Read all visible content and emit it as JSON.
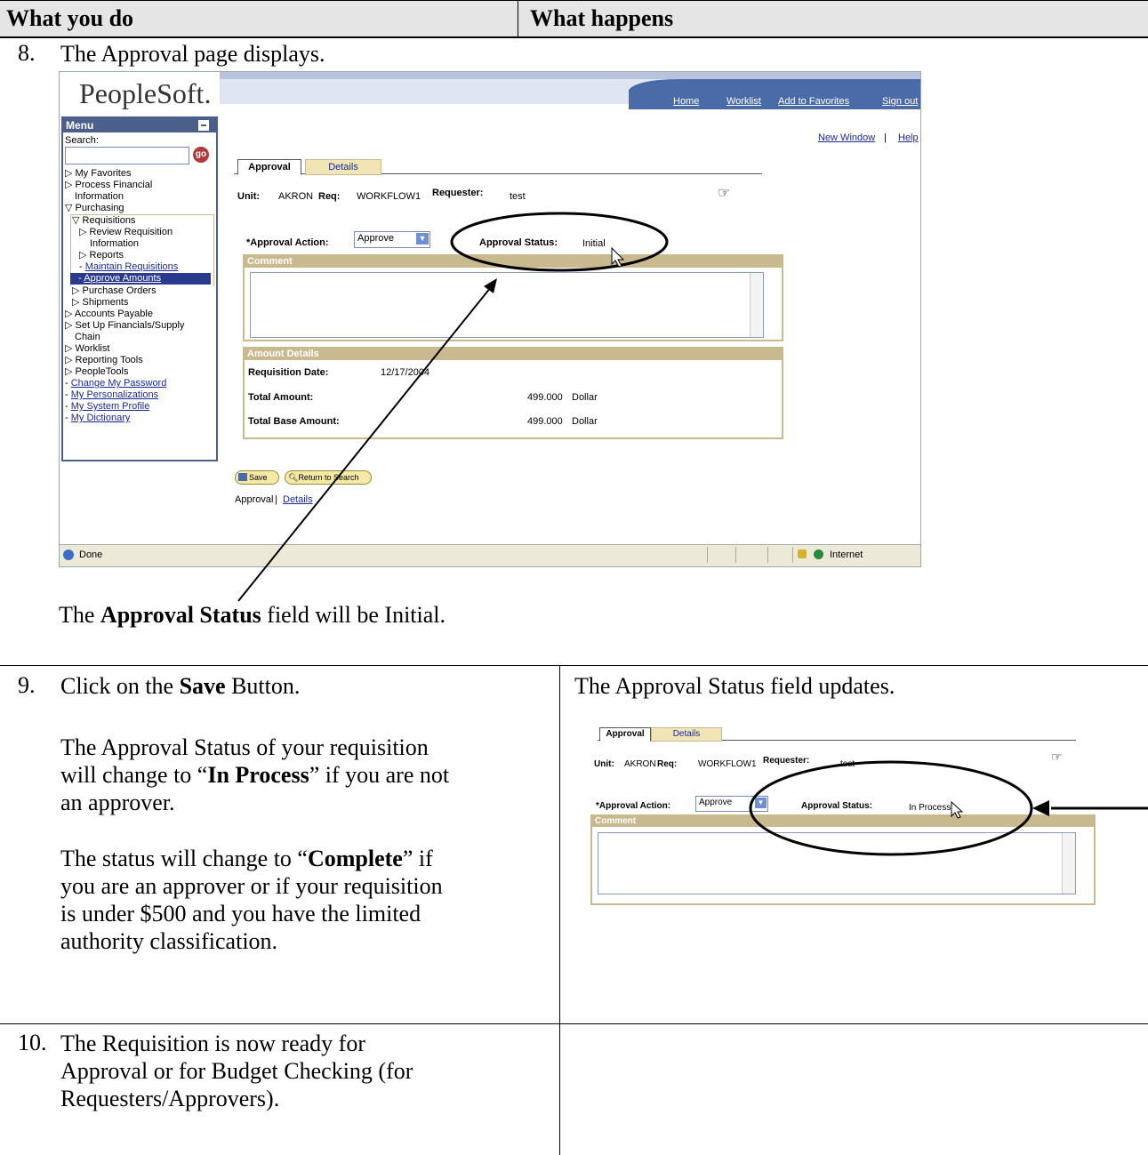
{
  "header": {
    "col1": "What you do",
    "col2": "What happens"
  },
  "step8": {
    "num": "8.",
    "text": "The Approval page displays.",
    "caption_pre": "The ",
    "caption_bold": "Approval Status",
    "caption_post": " field will be Initial."
  },
  "ps": {
    "logo": "PeopleSoft.",
    "nav": [
      "Home",
      "Worklist",
      "Add to Favorites",
      "Sign out"
    ],
    "new_window": "New Window",
    "help": "Help",
    "menu_title": "Menu",
    "search_label": "Search:",
    "go": "go",
    "menu_items": [
      "My Favorites",
      "Process Financial",
      "Information",
      "Purchasing",
      "Requisitions",
      "Review Requisition",
      "Information",
      "Reports",
      "Maintain Requisitions",
      "Approve Amounts",
      "Purchase Orders",
      "Shipments",
      "Accounts Payable",
      "Set Up Financials/Supply",
      "Chain",
      "Worklist",
      "Reporting Tools",
      "PeopleTools",
      "Change My Password",
      "My Personalizations",
      "My System Profile",
      "My Dictionary"
    ],
    "tab_approval": "Approval",
    "tab_details": "Details",
    "unit_label": "Unit:",
    "unit_value": "AKRON",
    "req_label": "Req:",
    "req_value": "WORKFLOW1",
    "requester_label": "Requester:",
    "requester_value": "test",
    "action_label": "*Approval Action:",
    "action_value": "Approve",
    "status_label": "Approval Status:",
    "status_value": "Initial",
    "comment_header": "Comment",
    "amount_header": "Amount Details",
    "req_date_label": "Requisition Date:",
    "req_date_value": "12/17/2004",
    "total_label": "Total Amount:",
    "total_value": "499.000",
    "total_currency": "Dollar",
    "base_label": "Total Base Amount:",
    "base_value": "499.000",
    "base_currency": "Dollar",
    "save": "Save",
    "return": "Return to Search",
    "footer_approval": "Approval",
    "footer_details": "Details",
    "status_done": "Done",
    "status_zone": "Internet"
  },
  "step9": {
    "num": "9.",
    "l1_pre": "Click on the ",
    "l1_bold": "Save",
    "l1_post": " Button.",
    "p2_1": "The Approval Status of your requisition",
    "p2_2_pre": "will change to “",
    "p2_2_bold": "In Process",
    "p2_2_post": "” if you are not",
    "p2_3": "an approver.",
    "p3_1_pre": "The status will change to “",
    "p3_1_bold": "Complete",
    "p3_1_post": "” if",
    "p3_2": "you are an approver or if your requisition",
    "p3_3": "is under $500 and you have the limited",
    "p3_4": "authority classification.",
    "right": "The Approval Status field updates."
  },
  "ps2": {
    "tab_approval": "Approval",
    "tab_details": "Details",
    "unit_label": "Unit:",
    "unit_value": "AKRON",
    "req_label": "Req:",
    "req_value": "WORKFLOW1",
    "requester_label": "Requester:",
    "requester_value": "test",
    "action_label": "*Approval Action:",
    "action_value": "Approve",
    "status_label": "Approval Status:",
    "status_value": "In Process",
    "comment_header": "Comment"
  },
  "step10": {
    "num": "10.",
    "l1": "The Requisition is now ready for",
    "l2": "Approval or for Budget Checking (for",
    "l3": "Requesters/Approvers)."
  }
}
